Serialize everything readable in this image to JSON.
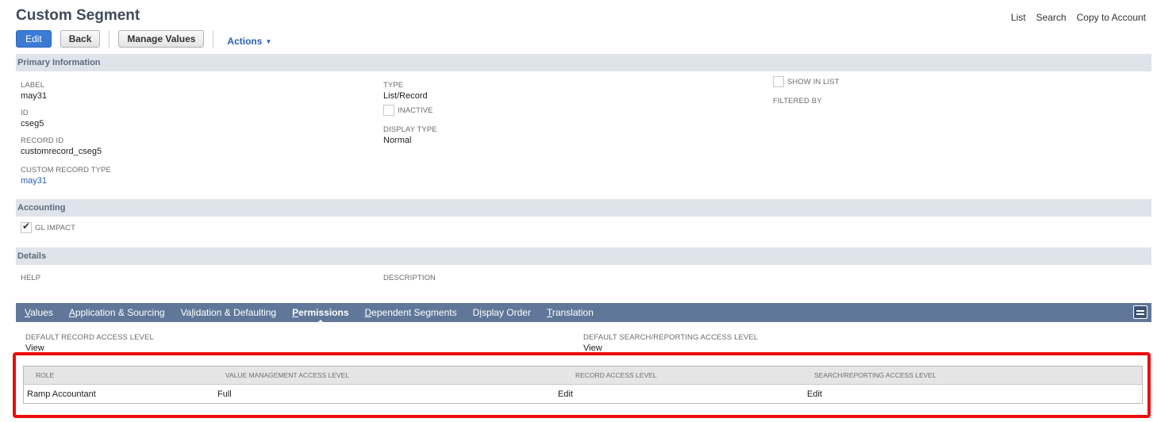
{
  "page": {
    "title": "Custom Segment"
  },
  "top_links": [
    "List",
    "Search",
    "Copy to Account"
  ],
  "toolbar": {
    "edit": "Edit",
    "back": "Back",
    "manage_values": "Manage Values",
    "actions": "Actions"
  },
  "primary": {
    "title": "Primary Information",
    "label": {
      "label": "LABEL",
      "value": "may31"
    },
    "id": {
      "label": "ID",
      "value": "cseg5"
    },
    "record_id": {
      "label": "RECORD ID",
      "value": "customrecord_cseg5"
    },
    "custom_record_type": {
      "label": "CUSTOM RECORD TYPE",
      "value": "may31"
    },
    "type": {
      "label": "TYPE",
      "value": "List/Record"
    },
    "inactive": {
      "label": "INACTIVE",
      "checked": false
    },
    "display_type": {
      "label": "DISPLAY TYPE",
      "value": "Normal"
    },
    "show_in_list": {
      "label": "SHOW IN LIST",
      "checked": false
    },
    "filtered_by": {
      "label": "FILTERED BY"
    }
  },
  "accounting": {
    "title": "Accounting",
    "gl_impact": {
      "label": "GL IMPACT",
      "checked": true
    }
  },
  "details": {
    "title": "Details",
    "help": "HELP",
    "description": "DESCRIPTION"
  },
  "tabs": [
    {
      "pre": "",
      "ul": "V",
      "post": "alues"
    },
    {
      "pre": "",
      "ul": "A",
      "post": "pplication & Sourcing"
    },
    {
      "pre": "Va",
      "ul": "l",
      "post": "idation & Defaulting"
    },
    {
      "pre": "",
      "ul": "P",
      "post": "ermissions",
      "active": true
    },
    {
      "pre": "",
      "ul": "D",
      "post": "ependent Segments"
    },
    {
      "pre": "D",
      "ul": "i",
      "post": "splay Order"
    },
    {
      "pre": "",
      "ul": "T",
      "post": "ranslation"
    }
  ],
  "permissions": {
    "default_record": {
      "label": "DEFAULT RECORD ACCESS LEVEL",
      "value": "View"
    },
    "default_search": {
      "label": "DEFAULT SEARCH/REPORTING ACCESS LEVEL",
      "value": "View"
    },
    "columns": [
      "ROLE",
      "VALUE MANAGEMENT ACCESS LEVEL",
      "RECORD ACCESS LEVEL",
      "SEARCH/REPORTING ACCESS LEVEL"
    ],
    "rows": [
      [
        "Ramp Accountant",
        "Full",
        "Edit",
        "Edit"
      ]
    ]
  }
}
